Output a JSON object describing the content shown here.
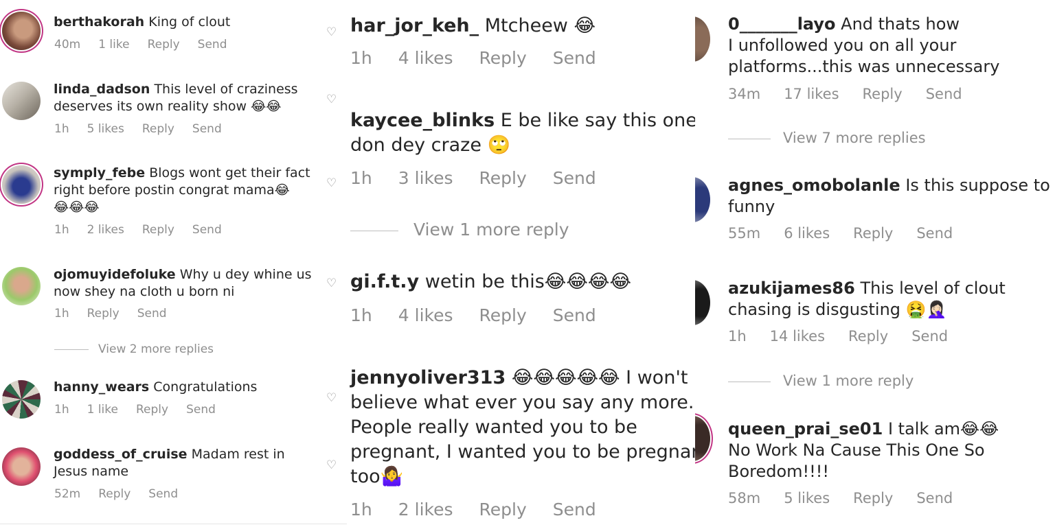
{
  "left": {
    "comments": [
      {
        "user": "berthakorah",
        "text": "King of clout",
        "time": "40m",
        "likes": "1 like",
        "reply": "Reply",
        "send": "Send"
      },
      {
        "user": "linda_dadson",
        "text": "This level of craziness",
        "text2": "deserves its own reality show 😂😂",
        "time": "1h",
        "likes": "5 likes",
        "reply": "Reply",
        "send": "Send"
      },
      {
        "user": "symply_febe",
        "text": "Blogs wont get their fact",
        "text2": "right before postin  congrat mama😂",
        "text3": "😂😂😂",
        "time": "1h",
        "likes": "2 likes",
        "reply": "Reply",
        "send": "Send"
      },
      {
        "user": "ojomuyidefoluke",
        "text": "Why u dey whine us",
        "text2": "now shey na cloth u born ni",
        "time": "1h",
        "reply": "Reply",
        "send": "Send"
      },
      {
        "user": "hanny_wears",
        "text": "Congratulations",
        "time": "1h",
        "likes": "1 like",
        "reply": "Reply",
        "send": "Send"
      },
      {
        "user": "goddess_of_cruise",
        "text": "Madam rest in",
        "text2": "Jesus name",
        "time": "52m",
        "reply": "Reply",
        "send": "Send"
      }
    ],
    "view_more": "View 2 more replies"
  },
  "middle": {
    "comments": [
      {
        "user": "har_jor_keh_",
        "text": "Mtcheew 😂",
        "time": "1h",
        "likes": "4 likes",
        "reply": "Reply",
        "send": "Send"
      },
      {
        "user": "kaycee_blinks",
        "text": "E be like say this one",
        "text2": "don dey craze 🙄",
        "time": "1h",
        "likes": "3 likes",
        "reply": "Reply",
        "send": "Send"
      },
      {
        "user": "gi.f.t.y",
        "text": "wetin be this😂😂😂😂",
        "time": "1h",
        "likes": "4 likes",
        "reply": "Reply",
        "send": "Send"
      },
      {
        "user": "jennyoliver313",
        "text": "😂😂😂😂😂 I won't",
        "text2": "believe what ever you say any more.",
        "text3": "People really wanted you to be",
        "text4": "pregnant, I wanted you to be pregnan",
        "text5": "too🤷‍♀️",
        "time": "1h",
        "likes": "2 likes",
        "reply": "Reply",
        "send": "Send"
      }
    ],
    "view_more": "View 1 more reply"
  },
  "right": {
    "comments": [
      {
        "user": "0_______layo",
        "text": "And thats how",
        "text2": "I unfollowed you on all your",
        "text3": "platforms...this was unnecessary",
        "time": "34m",
        "likes": "17 likes",
        "reply": "Reply",
        "send": "Send"
      },
      {
        "user": "agnes_omobolanle",
        "text": "Is this suppose to b",
        "text2": "funny",
        "time": "55m",
        "likes": "6 likes",
        "reply": "Reply",
        "send": "Send"
      },
      {
        "user": "azukijames86",
        "text": "This level of clout",
        "text2": "chasing is disgusting 🤮🤦🏻‍♀️",
        "time": "1h",
        "likes": "14 likes",
        "reply": "Reply",
        "send": "Send"
      },
      {
        "user": "queen_prai_se01",
        "text": "I talk am😂😂",
        "text2": "No Work Na Cause This One So",
        "text3": "Boredom!!!!",
        "time": "58m",
        "likes": "5 likes",
        "reply": "Reply",
        "send": "Send"
      }
    ],
    "view_more_1": "View 7 more replies",
    "view_more_2": "View 1 more reply"
  },
  "icons": {
    "heart": "heart-outline-icon"
  },
  "colors": {
    "text": "#262626",
    "meta": "#8e8e8e",
    "story_ring": "#c13584"
  }
}
